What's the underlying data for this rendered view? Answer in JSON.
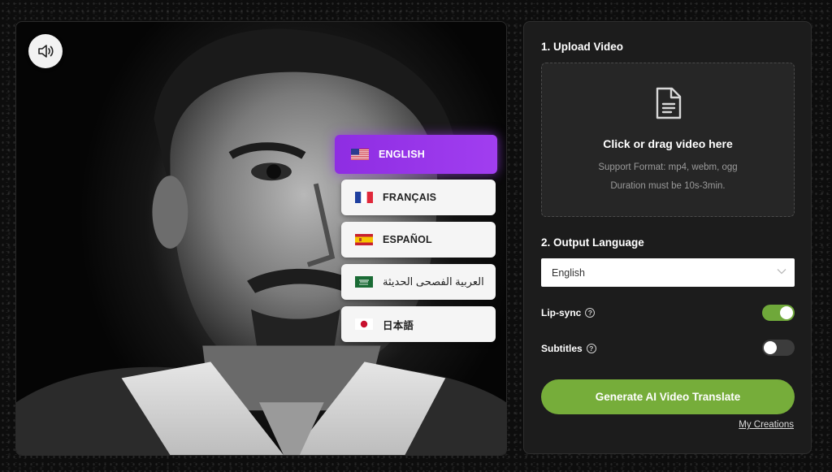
{
  "video": {
    "sound_icon": "speaker-icon",
    "languages": [
      {
        "label": "ENGLISH",
        "flag": "us-flag-icon",
        "active": true
      },
      {
        "label": "FRANÇAIS",
        "flag": "france-flag-icon",
        "active": false
      },
      {
        "label": "ESPAÑOL",
        "flag": "spain-flag-icon",
        "active": false
      },
      {
        "label": "العربية الفصحى الحديثة",
        "flag": "saudi-flag-icon",
        "active": false
      },
      {
        "label": "日本語",
        "flag": "japan-flag-icon",
        "active": false
      }
    ]
  },
  "panel": {
    "upload": {
      "title": "1. Upload Video",
      "icon": "document-icon",
      "main_text": "Click or drag video here",
      "format_text": "Support Format: mp4, webm, ogg",
      "duration_text": "Duration must be 10s-3min."
    },
    "output": {
      "title": "2. Output Language",
      "selected": "English"
    },
    "lip_sync": {
      "label": "Lip-sync",
      "enabled": true
    },
    "subtitles": {
      "label": "Subtitles",
      "enabled": false
    },
    "generate_label": "Generate AI Video Translate",
    "my_creations_label": "My Creations"
  },
  "colors": {
    "accent_purple": "#9b37ec",
    "accent_green": "#76ad3a",
    "panel_bg": "#1c1c1c"
  }
}
